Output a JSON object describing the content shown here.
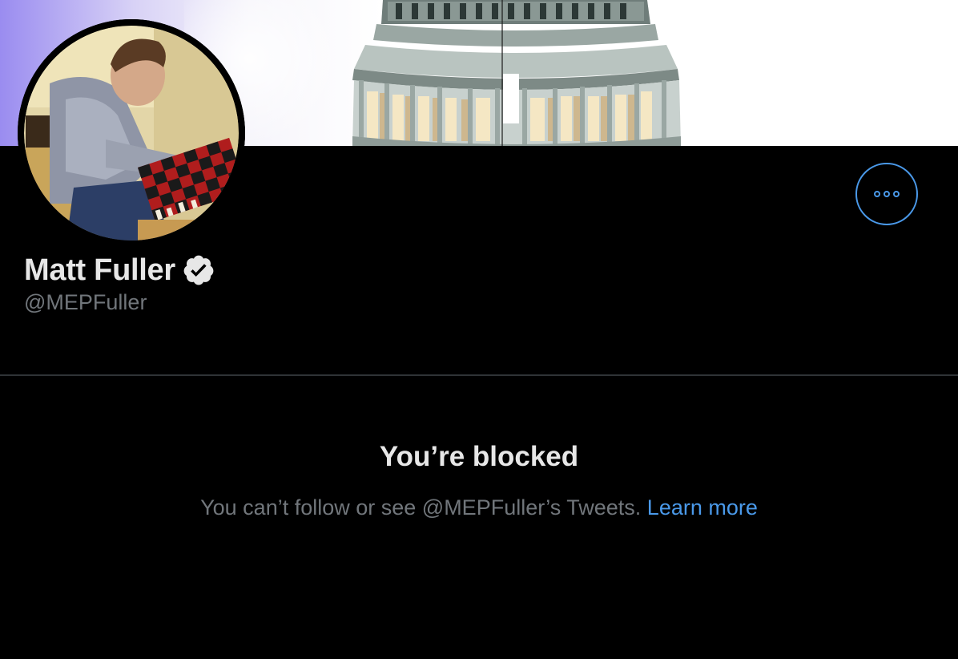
{
  "profile": {
    "display_name": "Matt Fuller",
    "handle": "@MEPFuller",
    "verified": true
  },
  "blocked": {
    "title": "You’re blocked",
    "message": "You can’t follow or see @MEPFuller’s Tweets.",
    "learn_more": "Learn more"
  },
  "icons": {
    "more": "more-options-icon",
    "verified": "verified-badge-icon"
  },
  "colors": {
    "background": "#000000",
    "accent": "#4a99e9",
    "primary_text": "#e7e7e7",
    "secondary_text": "#71767b",
    "divider": "#2f3336"
  }
}
